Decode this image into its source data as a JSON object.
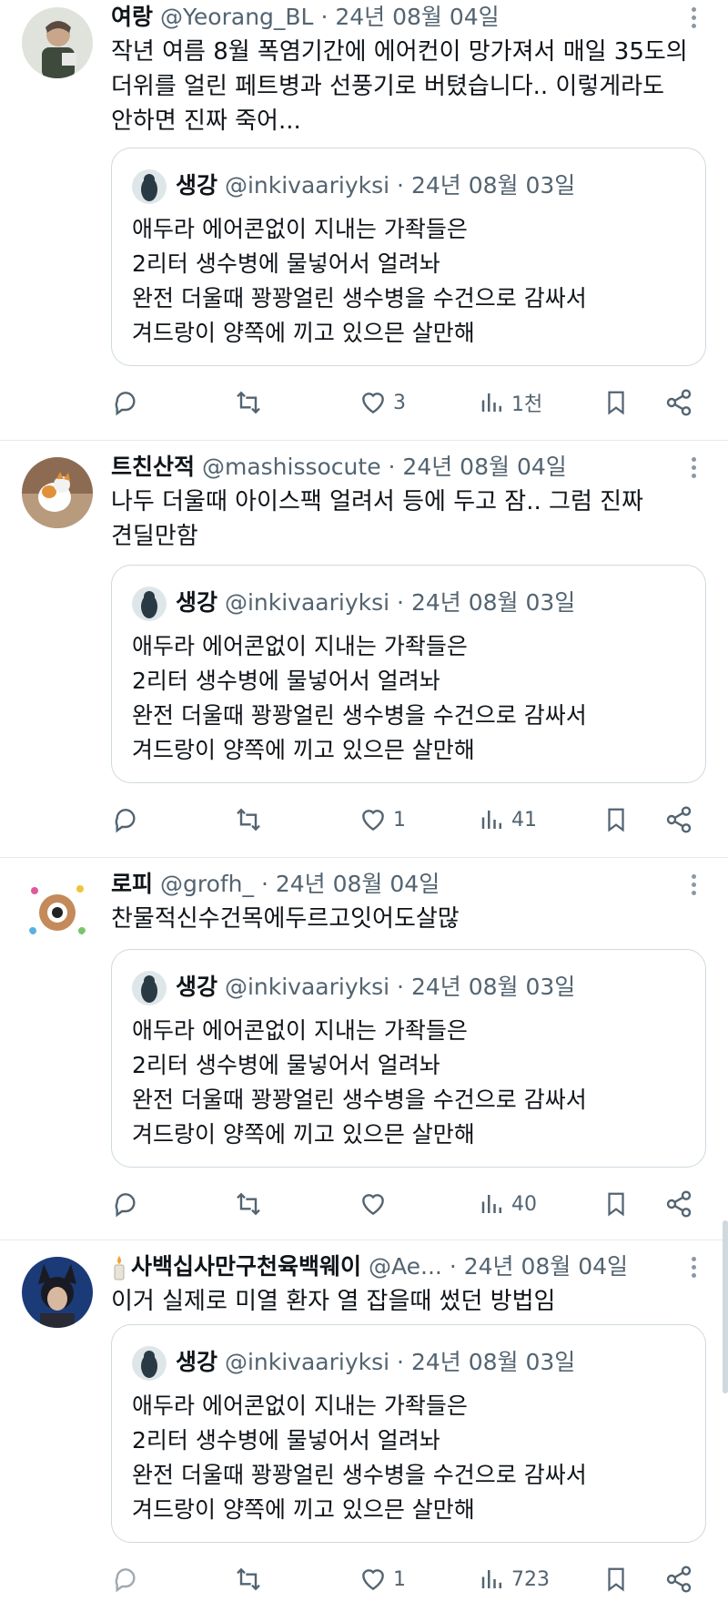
{
  "quoted": {
    "name": "생강",
    "handle": "@inkivaariyksi",
    "date": "· 24년 08월 03일",
    "text": "애두라 에어콘없이 지내는 가좍들은\n2리터 생수병에 물넣어서 얼려놔\n완전 더울때 꽝꽝얼린 생수병을 수건으로 감싸서\n겨드랑이 양쪽에 끼고 있으믄 살만해"
  },
  "tweets": [
    {
      "name": "여랑",
      "handle": "@Yeorang_BL",
      "date": "· 24년 08월 04일",
      "text": "작년 여름 8월 폭염기간에 에어컨이 망가져서 매일 35도의\n더위를 얼린 페트병과 선풍기로 버텼습니다.. 이렇게라도\n안하면 진짜 죽어...",
      "likes": "3",
      "views": "1천"
    },
    {
      "name": "트친산적",
      "handle": "@mashissocute",
      "date": "· 24년 08월 04일",
      "text": "나두 더울때 아이스팩 얼려서 등에 두고 잠.. 그럼 진짜\n견딜만함",
      "likes": "1",
      "views": "41"
    },
    {
      "name": "로피",
      "handle": "@grofh_",
      "date": "· 24년 08월 04일",
      "text": "찬물적신수건목에두르고잇어도살많",
      "likes": "",
      "views": "40"
    },
    {
      "name": "사백십사만구천육백웨이",
      "handle": "@Ae...",
      "date": "· 24년 08월 04일",
      "text": "이거 실제로 미열 환자 열 잡을때 썼던 방법임",
      "likes": "1",
      "views": "723"
    }
  ],
  "icons": {
    "reply": "reply-icon",
    "retweet": "retweet-icon",
    "like": "heart-icon",
    "views": "views-icon",
    "bookmark": "bookmark-icon",
    "share": "share-icon",
    "more": "more-icon",
    "candle": "candle-icon"
  },
  "colors": {
    "text": "#0f1419",
    "secondary": "#536471",
    "border": "#e7e9ea",
    "quote_border": "#cfd9de"
  }
}
